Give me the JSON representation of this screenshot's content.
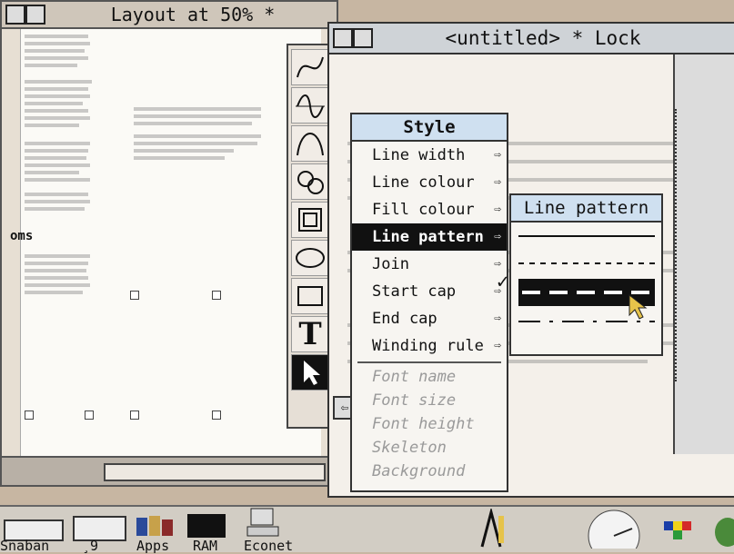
{
  "back_window": {
    "title": "Layout at 50% *",
    "visible_side_text": "oms"
  },
  "front_window": {
    "title": "<untitled> * Lock"
  },
  "tools": {
    "items": [
      "curve-tool",
      "wave-tool",
      "arc-tool",
      "freehand-tool",
      "frame-tool",
      "ellipse-tool",
      "rectangle-tool",
      "text-tool",
      "select-tool"
    ],
    "text_tool_glyph": "T"
  },
  "style_menu": {
    "title": "Style",
    "items": [
      {
        "label": "Line width",
        "has_submenu": true
      },
      {
        "label": "Line colour",
        "has_submenu": true
      },
      {
        "label": "Fill colour",
        "has_submenu": true
      },
      {
        "label": "Line pattern",
        "has_submenu": true,
        "selected": true
      },
      {
        "label": "Join",
        "has_submenu": true
      },
      {
        "label": "Start cap",
        "has_submenu": true
      },
      {
        "label": "End cap",
        "has_submenu": true
      },
      {
        "label": "Winding rule",
        "has_submenu": true
      }
    ],
    "disabled_items": [
      "Font name",
      "Font size",
      "Font height",
      "Skeleton",
      "Background"
    ],
    "arrow_glyph": "⇨"
  },
  "line_pattern_menu": {
    "title": "Line pattern",
    "patterns": [
      "solid",
      "dotted",
      "dashed",
      "dot-dash"
    ],
    "selected_index": 2,
    "check_glyph": "✓"
  },
  "iconbar": {
    "items": [
      "Snaban",
      "¸9",
      "Apps",
      "RAM",
      "Econet"
    ]
  },
  "colors": {
    "desktop": "#c7b6a2",
    "menu_title_bg": "#cfe0f0",
    "highlight": "#111111",
    "window_title_bg": "#cfd3d7"
  }
}
